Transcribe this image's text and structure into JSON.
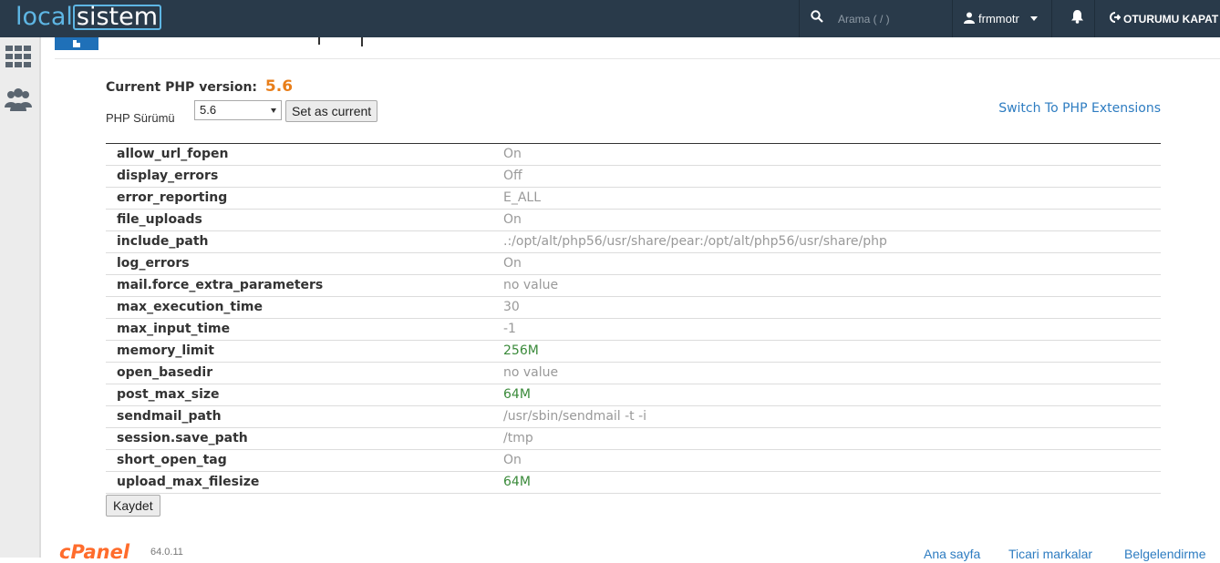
{
  "header": {
    "logo_part1": "local",
    "logo_part2": "sistem",
    "search_placeholder": "Arama ( / )",
    "username": "frmmotr",
    "logout_label": "OTURUMU KAPAT"
  },
  "sidebar": {
    "items": [
      {
        "icon": "grid-icon"
      },
      {
        "icon": "users-icon"
      }
    ]
  },
  "main": {
    "current_version_label": "Current PHP version:",
    "current_version_value": "5.6",
    "php_version_label": "PHP Sürümü",
    "php_version_selected": "5.6",
    "set_current_label": "Set as current",
    "switch_extensions_label": "Switch To PHP Extensions",
    "save_label": "Kaydet",
    "options": [
      {
        "name": "allow_url_fopen",
        "value": "On",
        "modified": false
      },
      {
        "name": "display_errors",
        "value": "Off",
        "modified": false
      },
      {
        "name": "error_reporting",
        "value": "E_ALL",
        "modified": false
      },
      {
        "name": "file_uploads",
        "value": "On",
        "modified": false
      },
      {
        "name": "include_path",
        "value": ".:/opt/alt/php56/usr/share/pear:/opt/alt/php56/usr/share/php",
        "modified": false
      },
      {
        "name": "log_errors",
        "value": "On",
        "modified": false
      },
      {
        "name": "mail.force_extra_parameters",
        "value": "no value",
        "modified": false
      },
      {
        "name": "max_execution_time",
        "value": "30",
        "modified": false
      },
      {
        "name": "max_input_time",
        "value": "-1",
        "modified": false
      },
      {
        "name": "memory_limit",
        "value": "256M",
        "modified": true
      },
      {
        "name": "open_basedir",
        "value": "no value",
        "modified": false
      },
      {
        "name": "post_max_size",
        "value": "64M",
        "modified": true
      },
      {
        "name": "sendmail_path",
        "value": "/usr/sbin/sendmail -t -i",
        "modified": false
      },
      {
        "name": "session.save_path",
        "value": "/tmp",
        "modified": false
      },
      {
        "name": "short_open_tag",
        "value": "On",
        "modified": false
      },
      {
        "name": "upload_max_filesize",
        "value": "64M",
        "modified": true
      }
    ]
  },
  "footer": {
    "brand": "cPanel",
    "version": "64.0.11",
    "links": [
      "Ana sayfa",
      "Ticari markalar",
      "Belgelendirme"
    ]
  },
  "colors": {
    "topbar": "#293a4a",
    "accent_orange": "#e87e1a",
    "link_blue": "#2d7cc1",
    "modified_green": "#3a8a3a",
    "muted_value": "#999999"
  }
}
